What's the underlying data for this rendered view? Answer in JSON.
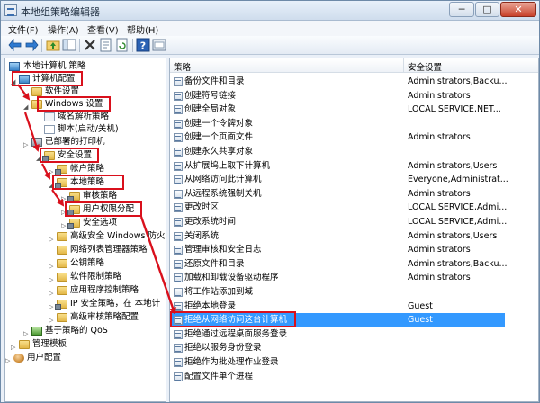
{
  "window": {
    "title": "本地组策略编辑器",
    "min_label": "─",
    "max_label": "□",
    "close_label": "✕"
  },
  "menu": [
    "文件(F)",
    "操作(A)",
    "查看(V)",
    "帮助(H)"
  ],
  "toolbar": {
    "icons": [
      "back-arrow-icon",
      "forward-arrow-icon",
      "up-folder-icon",
      "show-tree-icon",
      "delete-icon",
      "properties-icon",
      "refresh-icon",
      "export-icon",
      "help-icon",
      "console-icon"
    ]
  },
  "tree": {
    "root": "本地计算机 策略",
    "computer_config": "计算机配置",
    "software_settings": "软件设置",
    "windows_settings": "Windows 设置",
    "dns_policy": "域名解析策略",
    "scripts": "脚本(启动/关机)",
    "deployed_printers": "已部署的打印机",
    "security_settings": "安全设置",
    "account_policies": "帐户策略",
    "local_policies": "本地策略",
    "audit_policy": "审核策略",
    "user_rights": "用户权限分配",
    "security_options": "安全选项",
    "advanced_firewall": "高级安全 Windows 防火",
    "network_list": "网络列表管理器策略",
    "public_key": "公钥策略",
    "software_restriction": "软件限制策略",
    "app_control": "应用程序控制策略",
    "ipsec": "IP 安全策略，在 本地计",
    "advanced_audit": "高级审核策略配置",
    "qos": "基于策略的 QoS",
    "admin_templates": "管理模板",
    "user_config": "用户配置"
  },
  "list": {
    "col_policy": "策略",
    "col_setting": "安全设置",
    "rows": [
      {
        "policy": "备份文件和目录",
        "setting": "Administrators,Backu..."
      },
      {
        "policy": "创建符号链接",
        "setting": "Administrators"
      },
      {
        "policy": "创建全局对象",
        "setting": "LOCAL SERVICE,NET..."
      },
      {
        "policy": "创建一个令牌对象",
        "setting": ""
      },
      {
        "policy": "创建一个页面文件",
        "setting": "Administrators"
      },
      {
        "policy": "创建永久共享对象",
        "setting": ""
      },
      {
        "policy": "从扩展坞上取下计算机",
        "setting": "Administrators,Users"
      },
      {
        "policy": "从网络访问此计算机",
        "setting": "Everyone,Administrat..."
      },
      {
        "policy": "从远程系统强制关机",
        "setting": "Administrators"
      },
      {
        "policy": "更改时区",
        "setting": "LOCAL SERVICE,Admi..."
      },
      {
        "policy": "更改系统时间",
        "setting": "LOCAL SERVICE,Admi..."
      },
      {
        "policy": "关闭系统",
        "setting": "Administrators,Users"
      },
      {
        "policy": "管理审核和安全日志",
        "setting": "Administrators"
      },
      {
        "policy": "还原文件和目录",
        "setting": "Administrators,Backu..."
      },
      {
        "policy": "加载和卸载设备驱动程序",
        "setting": "Administrators"
      },
      {
        "policy": "将工作站添加到域",
        "setting": ""
      },
      {
        "policy": "拒绝本地登录",
        "setting": "Guest"
      },
      {
        "policy": "拒绝从网络访问这台计算机",
        "setting": "Guest"
      },
      {
        "policy": "拒绝通过远程桌面服务登录",
        "setting": ""
      },
      {
        "policy": "拒绝以服务身份登录",
        "setting": ""
      },
      {
        "policy": "拒绝作为批处理作业登录",
        "setting": ""
      },
      {
        "policy": "配置文件单个进程",
        "setting": ""
      }
    ],
    "selected_index": 17
  },
  "colors": {
    "highlight_red": "#d9101c",
    "selection_blue": "#3399ff"
  }
}
